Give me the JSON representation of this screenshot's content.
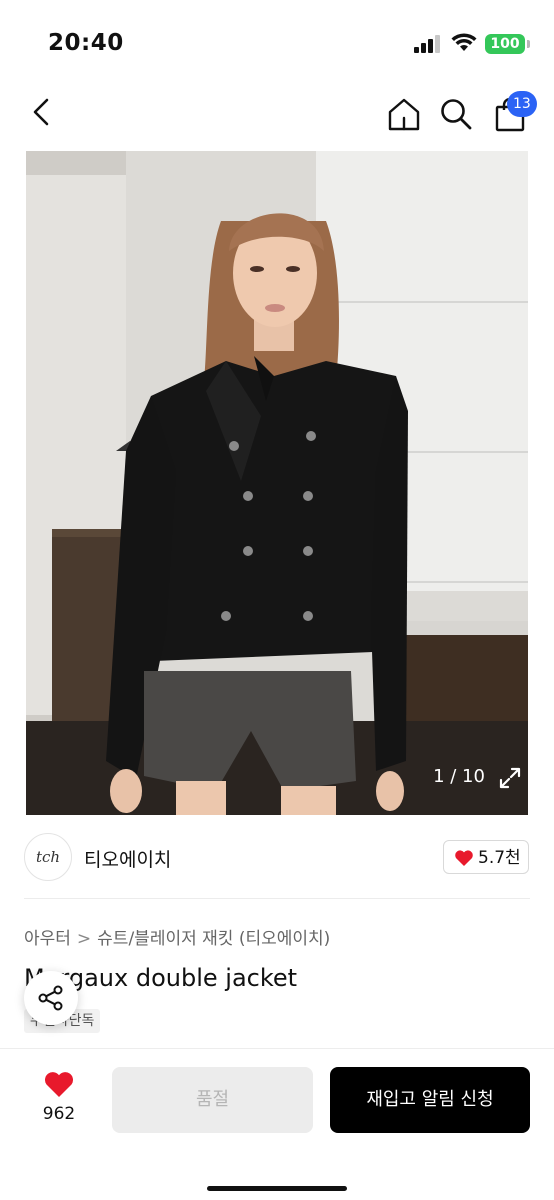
{
  "status_bar": {
    "time": "20:40",
    "battery": "100"
  },
  "nav": {
    "cart_count": "13"
  },
  "gallery": {
    "counter": "1 / 10"
  },
  "brand": {
    "logo_text": "tch",
    "name": "티오에이치",
    "likes": "5.7천"
  },
  "breadcrumb": {
    "category": "아우터",
    "separator": ">",
    "subcategory": "슈트/블레이저 재킷 (티오에이치)"
  },
  "product": {
    "title": "Margaux double jacket",
    "badge": "무신사단독"
  },
  "bottom_bar": {
    "wish_count": "962",
    "soldout_label": "품절",
    "restock_label": "재입고 알림 신청"
  },
  "colors": {
    "accent_blue": "#2b63f5",
    "heart_red": "#e8192c",
    "battery_green": "#34c759"
  }
}
